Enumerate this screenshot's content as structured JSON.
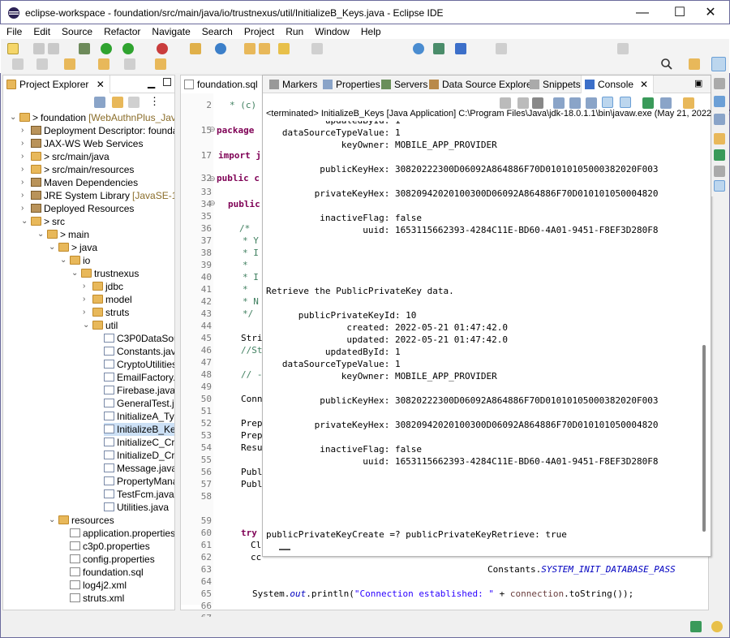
{
  "window": {
    "title": "eclipse-workspace - foundation/src/main/java/io/trustnexus/util/InitializeB_Keys.java - Eclipse IDE",
    "min": "—",
    "max": "☐",
    "close": "✕"
  },
  "menu": [
    "File",
    "Edit",
    "Source",
    "Refactor",
    "Navigate",
    "Search",
    "Project",
    "Run",
    "Window",
    "Help"
  ],
  "project_explorer": {
    "tab_label": "Project Explorer",
    "rows": [
      {
        "label": "foundation",
        "suffix": "[WebAuthnPlus_Java",
        "prefix": ">",
        "icon": "project-icon",
        "kind": "proj"
      },
      {
        "label": "Deployment Descriptor: foundat",
        "icon": "descriptor-icon",
        "kind": "lib"
      },
      {
        "label": "JAX-WS Web Services",
        "icon": "webservices-icon",
        "kind": "lib"
      },
      {
        "label": "src/main/java",
        "prefix": ">",
        "icon": "source-folder-icon",
        "kind": "folder"
      },
      {
        "label": "src/main/resources",
        "prefix": ">",
        "icon": "source-folder-icon",
        "kind": "folder"
      },
      {
        "label": "Maven Dependencies",
        "icon": "library-icon",
        "kind": "lib"
      },
      {
        "label": "JRE System Library",
        "suffix": "[JavaSE-1.8]",
        "icon": "library-icon",
        "kind": "lib"
      },
      {
        "label": "Deployed Resources",
        "icon": "deployed-icon",
        "kind": "lib"
      },
      {
        "label": "src",
        "prefix": ">",
        "icon": "folder-icon",
        "kind": "folder"
      },
      {
        "label": "main",
        "prefix": ">",
        "icon": "folder-icon",
        "kind": "folder"
      },
      {
        "label": "java",
        "prefix": ">",
        "icon": "folder-icon",
        "kind": "folder"
      },
      {
        "label": "io",
        "icon": "folder-icon",
        "kind": "folder"
      },
      {
        "label": "trustnexus",
        "icon": "folder-icon",
        "kind": "folder"
      },
      {
        "label": "jdbc",
        "icon": "folder-icon",
        "kind": "folder"
      },
      {
        "label": "model",
        "icon": "folder-icon",
        "kind": "folder"
      },
      {
        "label": "struts",
        "icon": "folder-icon",
        "kind": "folder"
      },
      {
        "label": "util",
        "icon": "folder-icon",
        "kind": "folder"
      },
      {
        "label": "C3P0DataSour",
        "icon": "java-file-icon",
        "kind": "jfile"
      },
      {
        "label": "Constants.java",
        "icon": "java-file-icon",
        "kind": "jfile"
      },
      {
        "label": "CryptoUtilities",
        "icon": "java-file-icon",
        "kind": "jfile"
      },
      {
        "label": "EmailFactory.j",
        "icon": "java-file-icon",
        "kind": "jfile"
      },
      {
        "label": "Firebase.java",
        "icon": "java-file-icon",
        "kind": "jfile"
      },
      {
        "label": "GeneralTest.jav",
        "icon": "java-file-icon",
        "kind": "jfile"
      },
      {
        "label": "InitializeA_Typ",
        "icon": "java-file-icon",
        "kind": "jfile"
      },
      {
        "label": "InitializeB_Key",
        "icon": "java-file-icon",
        "kind": "jfile",
        "selected": true
      },
      {
        "label": "InitializeC_Cre",
        "icon": "java-file-icon",
        "kind": "jfile"
      },
      {
        "label": "InitializeD_Cre",
        "icon": "java-file-icon",
        "kind": "jfile"
      },
      {
        "label": "Message.java",
        "icon": "java-file-icon",
        "kind": "jfile"
      },
      {
        "label": "PropertyMana",
        "icon": "java-file-icon",
        "kind": "jfile"
      },
      {
        "label": "TestFcm.java",
        "icon": "java-file-icon",
        "kind": "jfile"
      },
      {
        "label": "Utilities.java",
        "icon": "java-file-icon",
        "kind": "jfile"
      },
      {
        "label": "resources",
        "icon": "folder-icon",
        "kind": "folder"
      },
      {
        "label": "application.properties",
        "icon": "properties-file-icon",
        "kind": "pfile"
      },
      {
        "label": "c3p0.properties",
        "icon": "properties-file-icon",
        "kind": "pfile"
      },
      {
        "label": "config.properties",
        "icon": "properties-file-icon",
        "kind": "pfile"
      },
      {
        "label": "foundation.sql",
        "icon": "sql-file-icon",
        "kind": "pfile"
      },
      {
        "label": "log4j2.xml",
        "icon": "xml-file-icon",
        "kind": "pfile"
      },
      {
        "label": "struts.xml",
        "icon": "xml-file-icon",
        "kind": "pfile"
      }
    ]
  },
  "editor": {
    "tab_label": "foundation.sql",
    "lines": [
      {
        "n": "2",
        "text": "* (c) C"
      },
      {
        "n": "15",
        "text": "package"
      },
      {
        "n": "17",
        "text": "import j"
      },
      {
        "n": "32",
        "text": "public c"
      },
      {
        "n": "33",
        "text": ""
      },
      {
        "n": "34",
        "text": "public"
      },
      {
        "n": "35",
        "text": ""
      },
      {
        "n": "36",
        "text": "/*"
      },
      {
        "n": "37",
        "text": "* Y"
      },
      {
        "n": "38",
        "text": "* I"
      },
      {
        "n": "39",
        "text": "*"
      },
      {
        "n": "40",
        "text": "* I"
      },
      {
        "n": "41",
        "text": "*"
      },
      {
        "n": "42",
        "text": "* N"
      },
      {
        "n": "43",
        "text": "*/"
      },
      {
        "n": "44",
        "text": ""
      },
      {
        "n": "45",
        "text": "Stri"
      },
      {
        "n": "46",
        "text": "//St"
      },
      {
        "n": "47",
        "text": ""
      },
      {
        "n": "48",
        "text": "// -"
      },
      {
        "n": "49",
        "text": ""
      },
      {
        "n": "50",
        "text": "Conn"
      },
      {
        "n": "51",
        "text": ""
      },
      {
        "n": "52",
        "text": "Prep"
      },
      {
        "n": "53",
        "text": "Prep"
      },
      {
        "n": "54",
        "text": "Resu"
      },
      {
        "n": "55",
        "text": ""
      },
      {
        "n": "56",
        "text": "Publ"
      },
      {
        "n": "57",
        "text": "Publ"
      },
      {
        "n": "58",
        "text": ""
      },
      {
        "n": "59",
        "text": ""
      },
      {
        "n": "60",
        "text": "try"
      },
      {
        "n": "61",
        "text": "Cl"
      },
      {
        "n": "62",
        "text": "cc"
      },
      {
        "n": "63",
        "text": ""
      },
      {
        "n": "64",
        "text": "Constants.SYSTEM_INIT_DATABASE_PASS"
      },
      {
        "n": "65",
        "text": ""
      },
      {
        "n": "66",
        "text": "System.out.println(\"Connection established: \" + connection.toString());"
      },
      {
        "n": "67",
        "text": ""
      }
    ],
    "line64_prefix": "Constants.",
    "line64_field": "SYSTEM_INIT_DATABASE_PASS",
    "line66_a": "System.",
    "line66_out": "out",
    "line66_b": ".println(",
    "line66_str": "\"Connection established: \"",
    "line66_c": " + ",
    "line66_conn": "connection",
    "line66_d": ".toString());"
  },
  "console_view": {
    "tabs": [
      "Markers",
      "Properties",
      "Servers",
      "Data Source Explorer",
      "Snippets",
      "Console"
    ],
    "status": "<terminated> InitializeB_Keys [Java Application] C:\\Program Files\\Java\\jdk-18.0.1.1\\bin\\javaw.exe  (May 21, 2022, 1:47",
    "output": [
      "           updatedById: 1",
      "   dataSourceTypeValue: 1",
      "              keyOwner: MOBILE_APP_PROVIDER",
      "",
      "          publicKeyHex: 30820222300D06092A864886F70D01010105000382020F003",
      "",
      "         privateKeyHex: 30820942020100300D06092A864886F70D010101050004820",
      "",
      "          inactiveFlag: false",
      "                  uuid: 1653115662393-4284C11E-BD60-4A01-9451-F8EF3D280F8",
      "",
      "",
      "",
      "",
      "Retrieve the PublicPrivateKey data.",
      "",
      "      publicPrivateKeyId: 10",
      "               created: 2022-05-21 01:47:42.0",
      "               updated: 2022-05-21 01:47:42.0",
      "           updatedById: 1",
      "   dataSourceTypeValue: 1",
      "              keyOwner: MOBILE_APP_PROVIDER",
      "",
      "          publicKeyHex: 30820222300D06092A864886F70D01010105000382020F003",
      "",
      "         privateKeyHex: 30820942020100300D06092A864886F70D010101050004820",
      "",
      "          inactiveFlag: false",
      "                  uuid: 1653115662393-4284C11E-BD60-4A01-9451-F8EF3D280F8",
      "",
      "",
      "",
      "",
      "",
      "publicPrivateKeyCreate =? publicPrivateKeyRetrieve: true"
    ]
  },
  "colors": {
    "frame": "#6b6b9c",
    "selection": "#cce0f5",
    "keyword": "#7f0055",
    "string": "#2a00ff",
    "field": "#0000c0"
  }
}
